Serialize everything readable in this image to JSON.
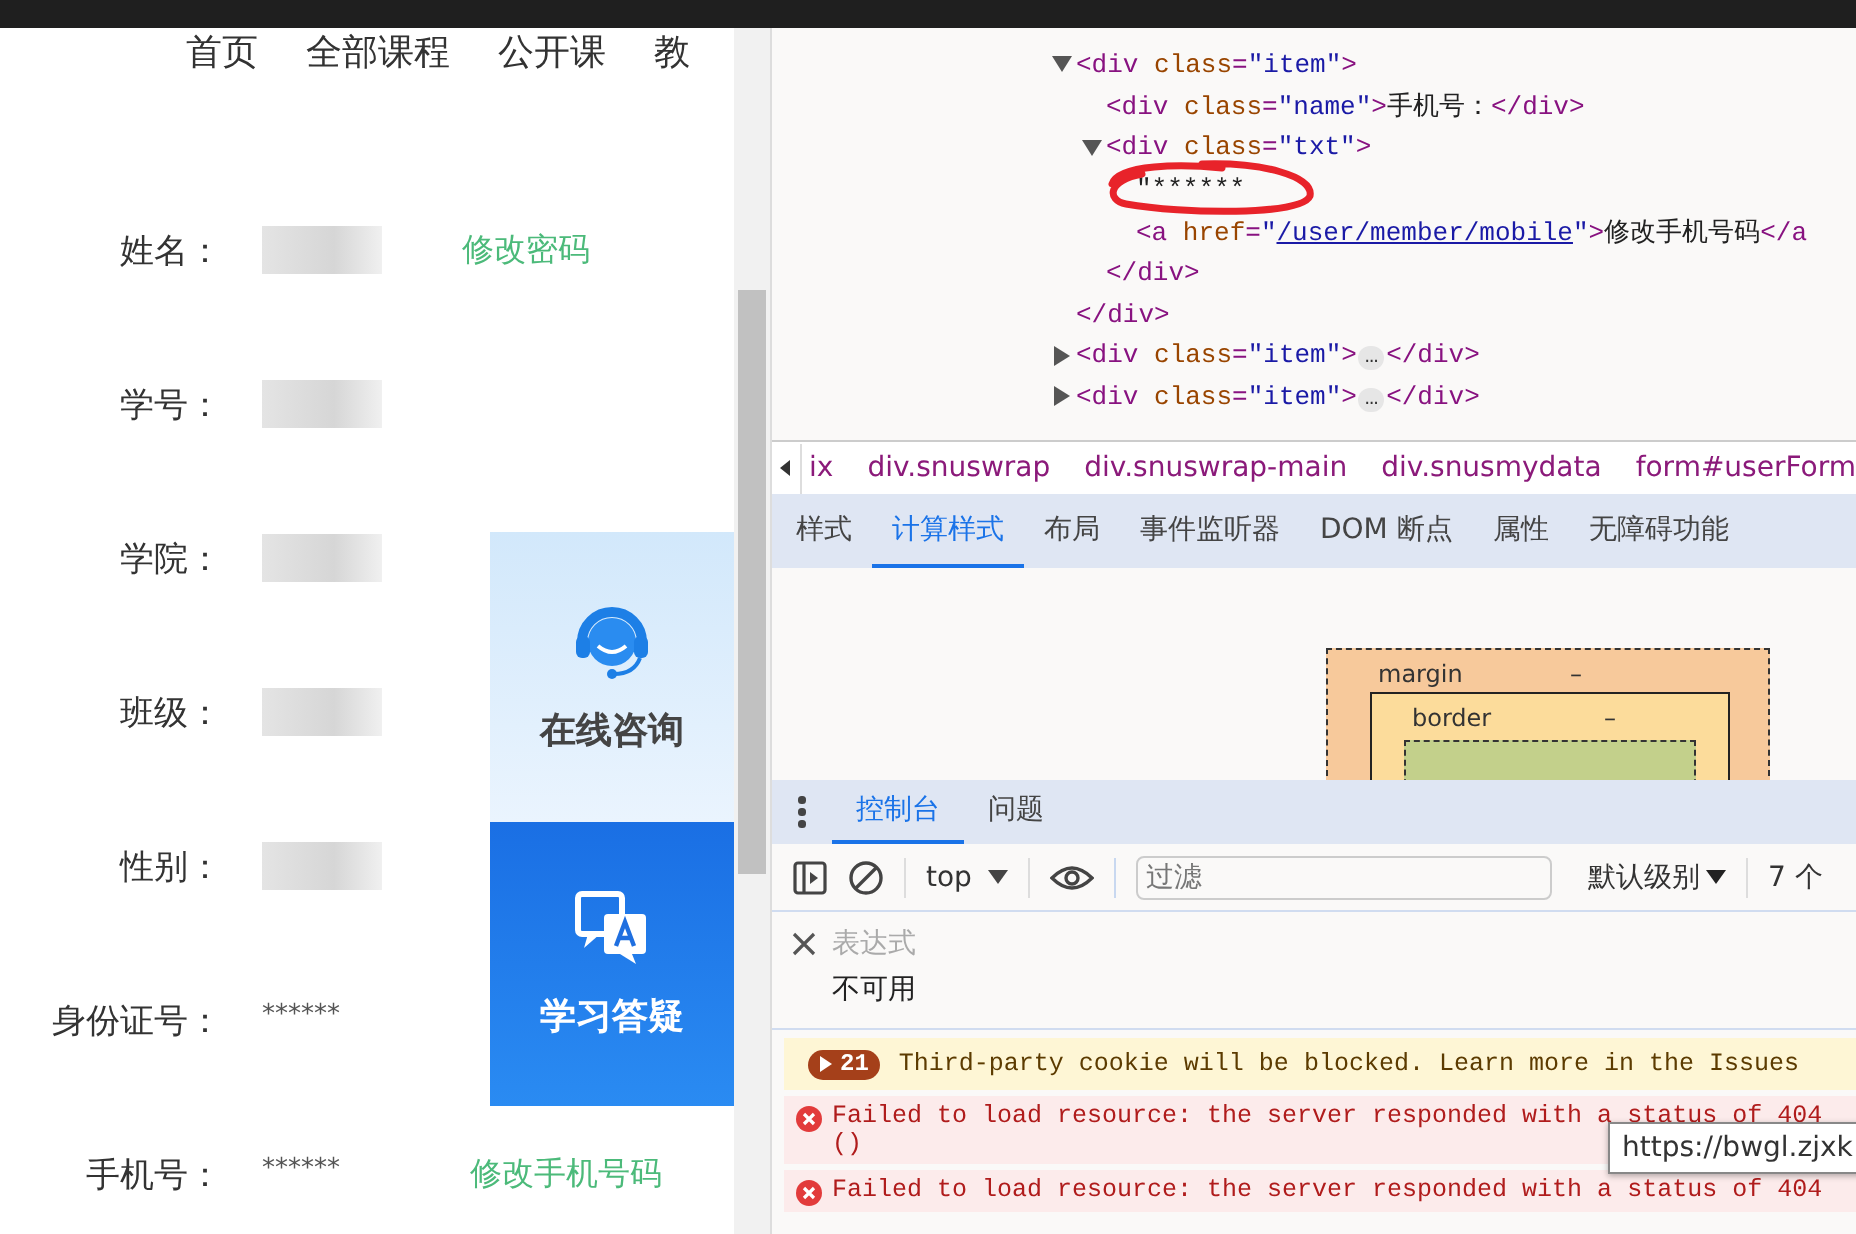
{
  "page": {
    "nav": [
      "首页",
      "全部课程",
      "公开课",
      "教"
    ],
    "fields": [
      {
        "label": "姓名：",
        "kind": "blurred",
        "link": "修改密码"
      },
      {
        "label": "学号：",
        "kind": "blurred"
      },
      {
        "label": "学院：",
        "kind": "blurred"
      },
      {
        "label": "班级：",
        "kind": "blurred"
      },
      {
        "label": "性别：",
        "kind": "blurred"
      },
      {
        "label": "身份证号：",
        "kind": "masked",
        "value": "******"
      },
      {
        "label": "手机号：",
        "kind": "masked",
        "value": "******",
        "link": "修改手机号码"
      }
    ],
    "float_panel": [
      {
        "kind": "headset",
        "label": "在线咨询"
      },
      {
        "kind": "qa",
        "label": "学习答疑"
      }
    ]
  },
  "devtools": {
    "elements": [
      {
        "expanded": true,
        "parts": [
          {
            "kind": "tag",
            "text": "<div"
          },
          {
            "kind": "attr",
            "text": " class"
          },
          {
            "kind": "tag",
            "text": "="
          },
          {
            "kind": "value",
            "text": "\"item\""
          },
          {
            "kind": "tag",
            "text": ">"
          }
        ],
        "children": [
          {
            "parts": [
              {
                "kind": "tag",
                "text": "<div"
              },
              {
                "kind": "attr",
                "text": " class"
              },
              {
                "kind": "tag",
                "text": "="
              },
              {
                "kind": "value",
                "text": "\"name\""
              },
              {
                "kind": "tag",
                "text": ">"
              },
              {
                "kind": "text",
                "text": "手机号："
              },
              {
                "kind": "tag",
                "text": "</div>"
              }
            ]
          },
          {
            "expanded": true,
            "parts": [
              {
                "kind": "tag",
                "text": "<div"
              },
              {
                "kind": "attr",
                "text": " class"
              },
              {
                "kind": "tag",
                "text": "="
              },
              {
                "kind": "value",
                "text": "\"txt\""
              },
              {
                "kind": "tag",
                "text": ">"
              }
            ],
            "children": [
              {
                "annotated": true,
                "parts": [
                  {
                    "kind": "text",
                    "text": "\"******"
                  }
                ]
              },
              {
                "parts": [
                  {
                    "kind": "tag",
                    "text": "<a"
                  },
                  {
                    "kind": "attr",
                    "text": " href"
                  },
                  {
                    "kind": "tag",
                    "text": "="
                  },
                  {
                    "kind": "value",
                    "text": "\""
                  },
                  {
                    "kind": "link",
                    "text": "/user/member/mobile"
                  },
                  {
                    "kind": "value",
                    "text": "\""
                  },
                  {
                    "kind": "tag",
                    "text": ">"
                  },
                  {
                    "kind": "text",
                    "text": "修改手机号码"
                  },
                  {
                    "kind": "tag",
                    "text": "</a"
                  }
                ]
              }
            ],
            "close": [
              {
                "kind": "tag",
                "text": "</div>"
              }
            ]
          }
        ],
        "close": [
          {
            "kind": "tag",
            "text": "</div>"
          }
        ]
      },
      {
        "expanded": false,
        "parts": [
          {
            "kind": "tag",
            "text": "<div"
          },
          {
            "kind": "attr",
            "text": " class"
          },
          {
            "kind": "tag",
            "text": "="
          },
          {
            "kind": "value",
            "text": "\"item\""
          },
          {
            "kind": "tag",
            "text": ">"
          },
          {
            "kind": "ellipsis",
            "text": "…"
          },
          {
            "kind": "tag",
            "text": "</div>"
          }
        ]
      },
      {
        "expanded": false,
        "parts": [
          {
            "kind": "tag",
            "text": "<div"
          },
          {
            "kind": "attr",
            "text": " class"
          },
          {
            "kind": "tag",
            "text": "="
          },
          {
            "kind": "value",
            "text": "\"item\""
          },
          {
            "kind": "tag",
            "text": ">"
          },
          {
            "kind": "ellipsis",
            "text": "…"
          },
          {
            "kind": "tag",
            "text": "</div>"
          }
        ]
      }
    ],
    "breadcrumb": [
      "ix",
      "div.snuswrap",
      "div.snuswrap-main",
      "div.snusmydata",
      "form#userForm"
    ],
    "tabs": [
      {
        "label": "样式",
        "selected": false
      },
      {
        "label": "计算样式",
        "selected": true
      },
      {
        "label": "布局",
        "selected": false
      },
      {
        "label": "事件监听器",
        "selected": false
      },
      {
        "label": "DOM 断点",
        "selected": false
      },
      {
        "label": "属性",
        "selected": false
      },
      {
        "label": "无障碍功能",
        "selected": false
      }
    ],
    "box_model": {
      "margin": {
        "label": "margin",
        "value": "–"
      },
      "border": {
        "label": "border",
        "value": "–"
      }
    },
    "drawer_tabs": [
      {
        "label": "控制台",
        "selected": true
      },
      {
        "label": "问题",
        "selected": false
      }
    ],
    "toolbar": {
      "context": "top",
      "filter_placeholder": "过滤",
      "levels": "默认级别",
      "count": "7 个"
    },
    "expression": {
      "placeholder": "表达式",
      "result": "不可用"
    },
    "messages": [
      {
        "kind": "warning",
        "count": "21",
        "text": "Third-party cookie will be blocked. Learn more in the Issues"
      },
      {
        "kind": "error",
        "text": "Failed to load resource: the server responded with a status of 404",
        "detail": "()"
      },
      {
        "kind": "error",
        "text": "Failed to load resource: the server responded with a status of 404"
      }
    ],
    "tooltip": "https://bwgl.zjxk"
  }
}
